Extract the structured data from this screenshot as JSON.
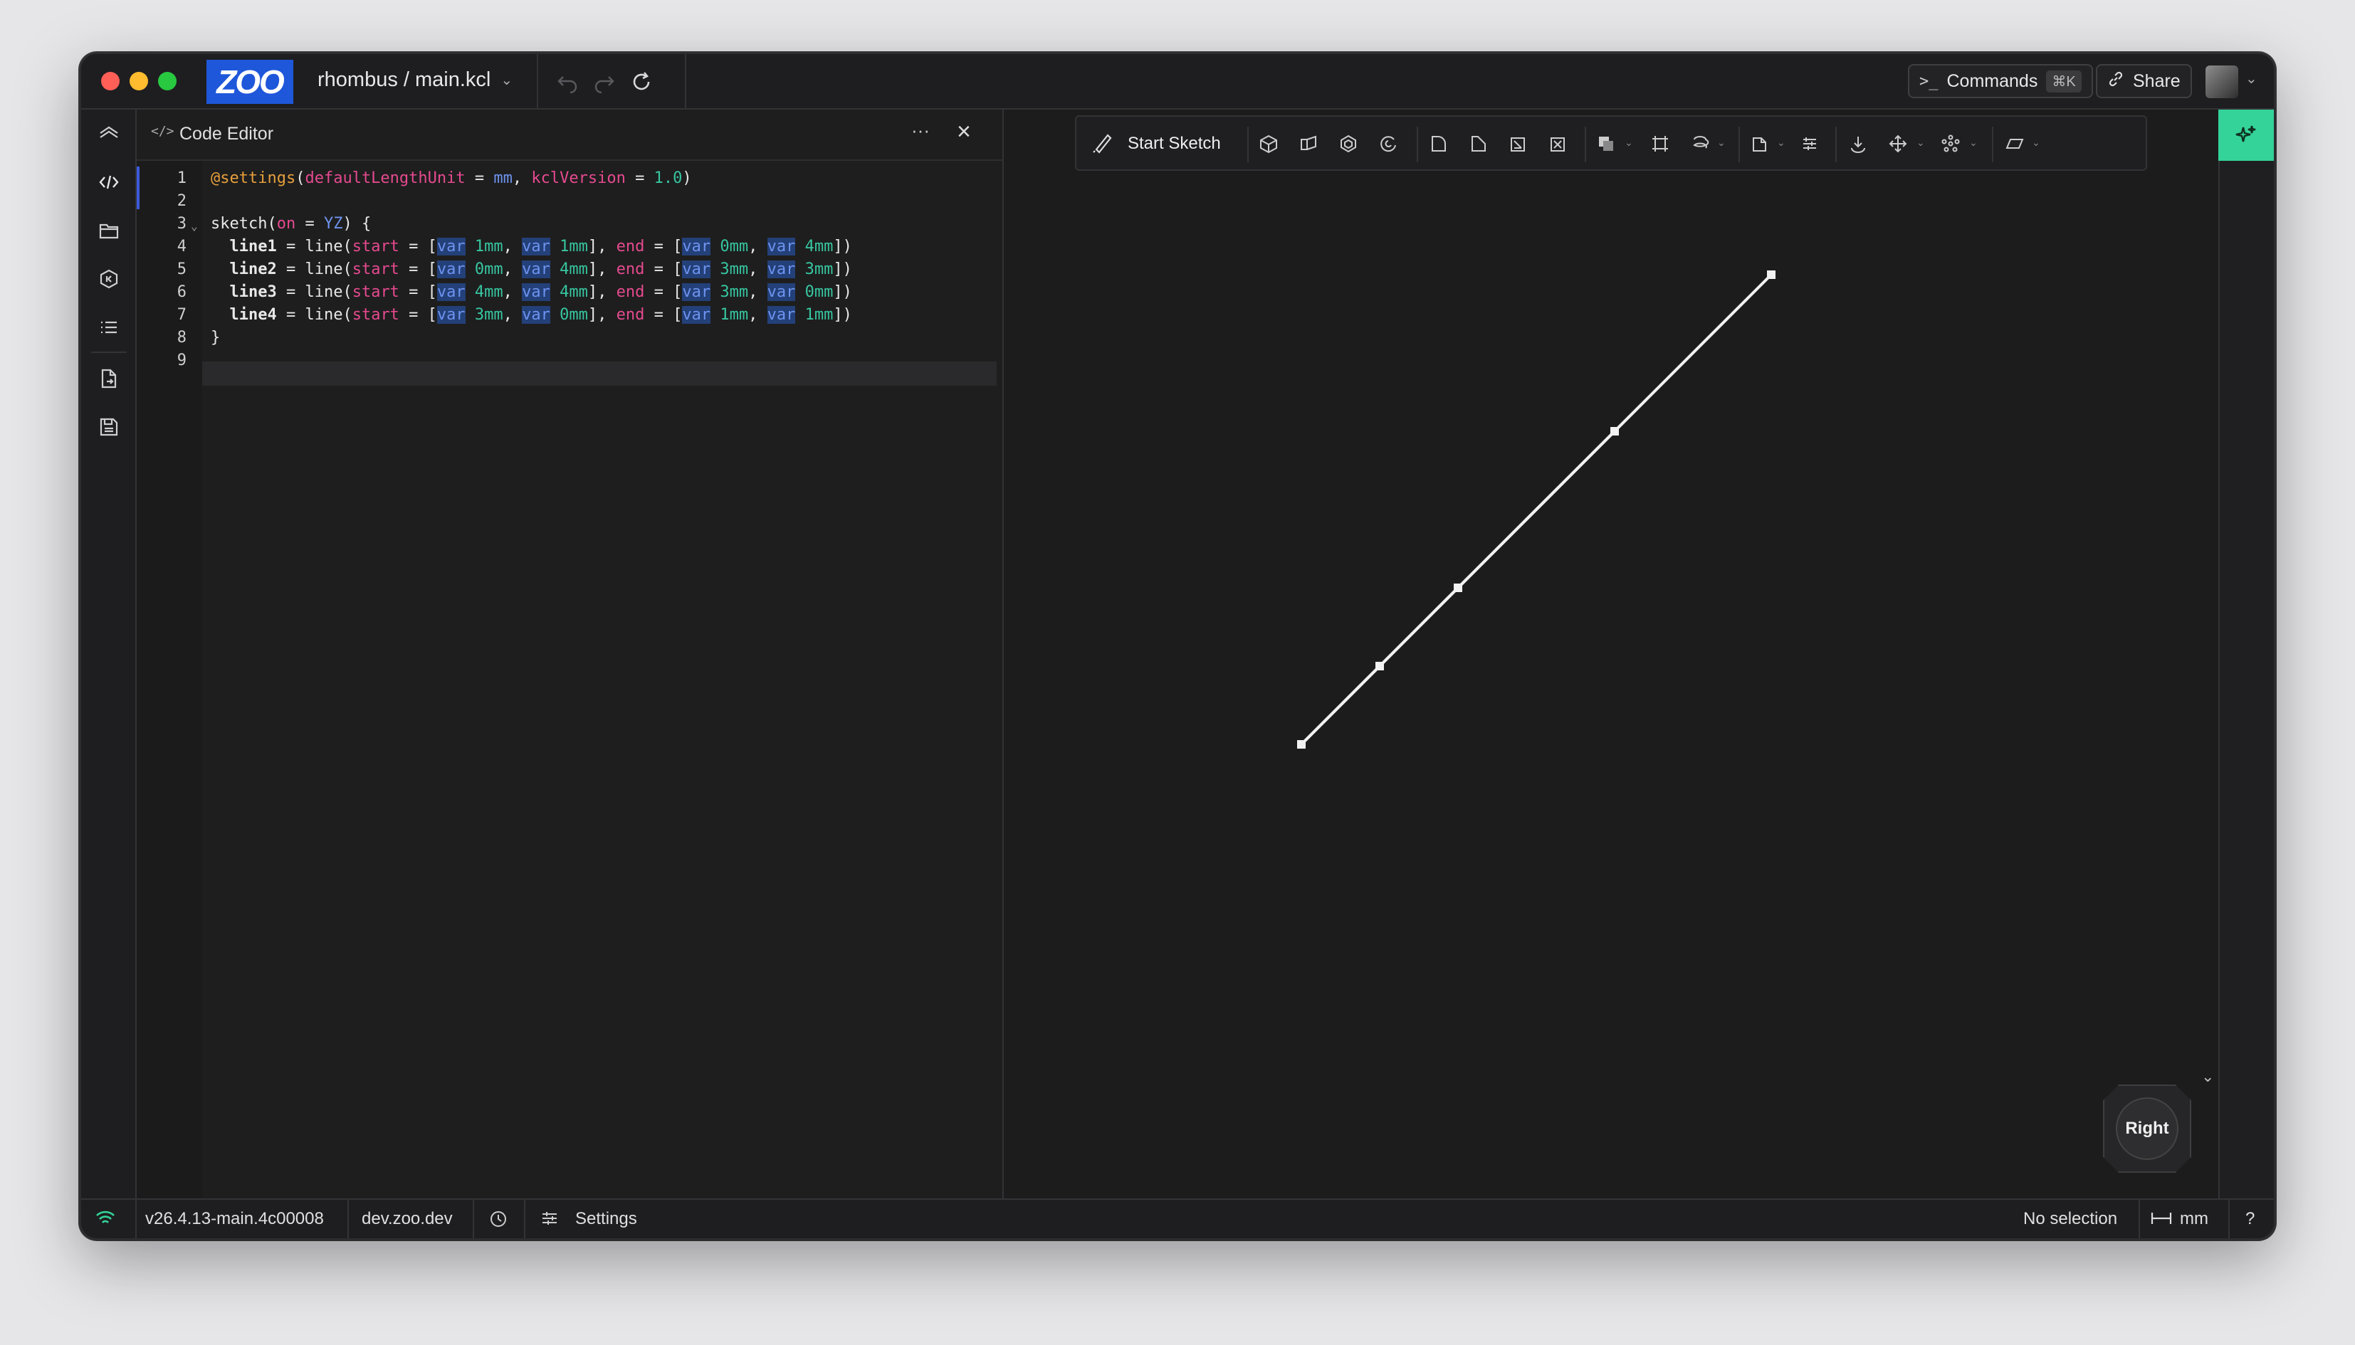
{
  "window": {
    "logo": "ZOO",
    "title": "rhombus / main.kcl",
    "commands_label": "Commands",
    "commands_shortcut": "⌘K",
    "share_label": "Share"
  },
  "editor": {
    "title": "Code Editor",
    "menu": "···",
    "close": "×"
  },
  "toolbar": {
    "start_sketch": "Start Sketch"
  },
  "view_cube": {
    "label": "Right"
  },
  "status_bar": {
    "version": "v26.4.13-main.4c00008",
    "server": "dev.zoo.dev",
    "settings": "Settings",
    "selection": "No selection",
    "units": "mm",
    "help": "?"
  },
  "code_lines": [
    {
      "n": "1",
      "fold": false,
      "parts": [
        [
          "at",
          "@settings"
        ],
        [
          "",
          "("
        ],
        [
          "kw",
          "defaultLengthUnit"
        ],
        [
          "",
          " = "
        ],
        [
          "ty",
          "mm"
        ],
        [
          "",
          ", "
        ],
        [
          "kw",
          "kclVersion"
        ],
        [
          "",
          " = "
        ],
        [
          "num",
          "1.0"
        ],
        [
          "",
          ")"
        ]
      ]
    },
    {
      "n": "2",
      "fold": false,
      "parts": []
    },
    {
      "n": "3",
      "fold": true,
      "parts": [
        [
          "",
          "sketch("
        ],
        [
          "kw",
          "on"
        ],
        [
          "",
          " = "
        ],
        [
          "ty",
          "YZ"
        ],
        [
          "",
          ") {"
        ]
      ]
    },
    {
      "n": "4",
      "fold": false,
      "parts": [
        [
          "",
          "  "
        ],
        [
          "b",
          "line1"
        ],
        [
          "",
          " = line("
        ],
        [
          "kw",
          "start"
        ],
        [
          "",
          " = ["
        ],
        [
          "var",
          "var"
        ],
        [
          "num",
          " 1mm"
        ],
        [
          "",
          ", "
        ],
        [
          "var",
          "var"
        ],
        [
          "num",
          " 1mm"
        ],
        [
          "",
          "], "
        ],
        [
          "kw",
          "end"
        ],
        [
          "",
          " = ["
        ],
        [
          "var",
          "var"
        ],
        [
          "num",
          " 0mm"
        ],
        [
          "",
          ", "
        ],
        [
          "var",
          "var"
        ],
        [
          "num",
          " 4mm"
        ],
        [
          "",
          "])"
        ]
      ]
    },
    {
      "n": "5",
      "fold": false,
      "parts": [
        [
          "",
          "  "
        ],
        [
          "b",
          "line2"
        ],
        [
          "",
          " = line("
        ],
        [
          "kw",
          "start"
        ],
        [
          "",
          " = ["
        ],
        [
          "var",
          "var"
        ],
        [
          "num",
          " 0mm"
        ],
        [
          "",
          ", "
        ],
        [
          "var",
          "var"
        ],
        [
          "num",
          " 4mm"
        ],
        [
          "",
          "], "
        ],
        [
          "kw",
          "end"
        ],
        [
          "",
          " = ["
        ],
        [
          "var",
          "var"
        ],
        [
          "num",
          " 3mm"
        ],
        [
          "",
          ", "
        ],
        [
          "var",
          "var"
        ],
        [
          "num",
          " 3mm"
        ],
        [
          "",
          "])"
        ]
      ]
    },
    {
      "n": "6",
      "fold": false,
      "parts": [
        [
          "",
          "  "
        ],
        [
          "b",
          "line3"
        ],
        [
          "",
          " = line("
        ],
        [
          "kw",
          "start"
        ],
        [
          "",
          " = ["
        ],
        [
          "var",
          "var"
        ],
        [
          "num",
          " 4mm"
        ],
        [
          "",
          ", "
        ],
        [
          "var",
          "var"
        ],
        [
          "num",
          " 4mm"
        ],
        [
          "",
          "], "
        ],
        [
          "kw",
          "end"
        ],
        [
          "",
          " = ["
        ],
        [
          "var",
          "var"
        ],
        [
          "num",
          " 3mm"
        ],
        [
          "",
          ", "
        ],
        [
          "var",
          "var"
        ],
        [
          "num",
          " 0mm"
        ],
        [
          "",
          "])"
        ]
      ]
    },
    {
      "n": "7",
      "fold": false,
      "parts": [
        [
          "",
          "  "
        ],
        [
          "b",
          "line4"
        ],
        [
          "",
          " = line("
        ],
        [
          "kw",
          "start"
        ],
        [
          "",
          " = ["
        ],
        [
          "var",
          "var"
        ],
        [
          "num",
          " 3mm"
        ],
        [
          "",
          ", "
        ],
        [
          "var",
          "var"
        ],
        [
          "num",
          " 0mm"
        ],
        [
          "",
          "], "
        ],
        [
          "kw",
          "end"
        ],
        [
          "",
          " = ["
        ],
        [
          "var",
          "var"
        ],
        [
          "num",
          " 1mm"
        ],
        [
          "",
          ", "
        ],
        [
          "var",
          "var"
        ],
        [
          "num",
          " 1mm"
        ],
        [
          "",
          "])"
        ]
      ]
    },
    {
      "n": "8",
      "fold": false,
      "parts": [
        [
          "",
          "}"
        ]
      ]
    },
    {
      "n": "9",
      "fold": false,
      "parts": []
    }
  ],
  "sketch_lines": [
    {
      "name": "line1",
      "start": [
        1,
        1
      ],
      "end": [
        0,
        4
      ]
    },
    {
      "name": "line2",
      "start": [
        0,
        4
      ],
      "end": [
        3,
        3
      ]
    },
    {
      "name": "line3",
      "start": [
        4,
        4
      ],
      "end": [
        3,
        0
      ]
    },
    {
      "name": "line4",
      "start": [
        3,
        0
      ],
      "end": [
        1,
        1
      ]
    }
  ],
  "colors": {
    "accent": "#1e57d9",
    "ai_button": "#34d399",
    "sketch": "#f2f2f2"
  }
}
